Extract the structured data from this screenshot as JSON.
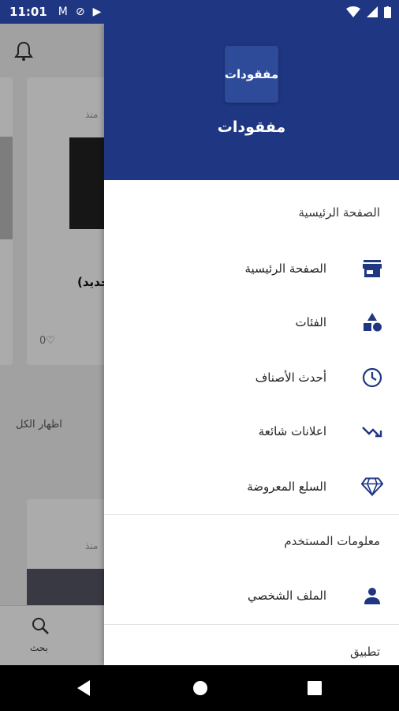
{
  "status_bar": {
    "time": "11:01"
  },
  "background_app": {
    "card_since": "منذ",
    "card_title_fragment": "(جديد",
    "likes": "0♡",
    "show_all_label": "اظهار الكل",
    "search_label": "بحث"
  },
  "drawer": {
    "logo_text": "مفقودات",
    "app_name": "مفقودات",
    "section_home": "الصفحة الرئيسية",
    "items": [
      {
        "label": "الصفحة الرئيسية",
        "icon": "store-icon"
      },
      {
        "label": "الفئات",
        "icon": "category-icon"
      },
      {
        "label": "أحدث الأصناف",
        "icon": "clock-icon"
      },
      {
        "label": "اعلانات شائعة",
        "icon": "trending-icon"
      },
      {
        "label": "السلع المعروضة",
        "icon": "diamond-icon"
      }
    ],
    "section_user": "معلومات المستخدم",
    "profile_label": "الملف الشخصي",
    "section_app": "تطبيق"
  },
  "colors": {
    "primary": "#1f3682",
    "icon": "#1f3682"
  }
}
